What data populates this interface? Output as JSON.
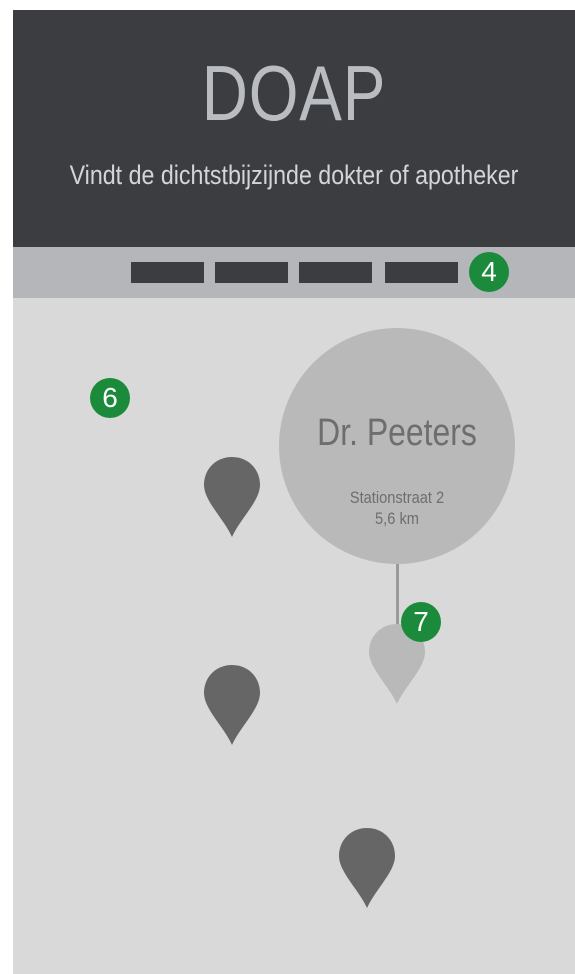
{
  "header": {
    "title": "DOAP",
    "subtitle": "Vindt de dichtstbijzijnde dokter of apotheker"
  },
  "nav": {
    "tab_count": 4
  },
  "annotations": {
    "nav_marker": "4",
    "map_marker": "6",
    "pin_marker": "7"
  },
  "selected_location": {
    "name": "Dr. Peeters",
    "address": "Stationstraat 2",
    "distance": "5,6 km"
  },
  "colors": {
    "header_bg": "#3b3d40",
    "nav_bg": "#b4b6b9",
    "map_bg": "#d9d9d9",
    "pin": "#666666",
    "selected_pin": "#b9b9b9",
    "badge": "#1b8a3a"
  }
}
